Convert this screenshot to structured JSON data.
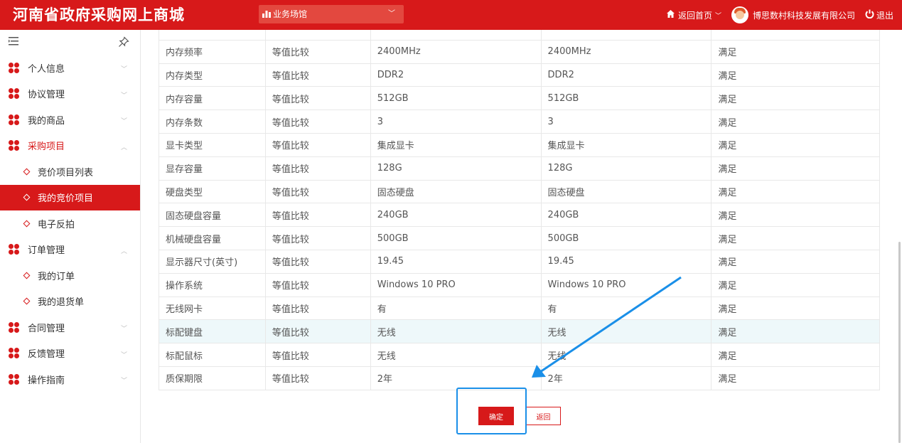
{
  "header": {
    "title": "河南省政府采购网上商城",
    "hall_label": "业务场馆",
    "home_label": "返回首页",
    "company": "博思数村科技发展有限公司",
    "logout_label": "退出"
  },
  "sidebar": {
    "items": [
      {
        "label": "个人信息",
        "level": "top",
        "state": "collapsed"
      },
      {
        "label": "协议管理",
        "level": "top",
        "state": "collapsed"
      },
      {
        "label": "我的商品",
        "level": "top",
        "state": "collapsed"
      },
      {
        "label": "采购项目",
        "level": "top",
        "state": "open"
      },
      {
        "label": "竞价项目列表",
        "level": "sub",
        "state": "normal"
      },
      {
        "label": "我的竞价项目",
        "level": "sub",
        "state": "active"
      },
      {
        "label": "电子反拍",
        "level": "sub",
        "state": "normal"
      },
      {
        "label": "订单管理",
        "level": "top",
        "state": "expanded"
      },
      {
        "label": "我的订单",
        "level": "sub",
        "state": "normal"
      },
      {
        "label": "我的退货单",
        "level": "sub",
        "state": "normal"
      },
      {
        "label": "合同管理",
        "level": "top",
        "state": "collapsed"
      },
      {
        "label": "反馈管理",
        "level": "top",
        "state": "collapsed"
      },
      {
        "label": "操作指南",
        "level": "top",
        "state": "collapsed"
      }
    ]
  },
  "table": {
    "rows": [
      [
        "",
        "",
        "",
        "",
        ""
      ],
      [
        "内存频率",
        "等值比较",
        "2400MHz",
        "2400MHz",
        "满足"
      ],
      [
        "内存类型",
        "等值比较",
        "DDR2",
        "DDR2",
        "满足"
      ],
      [
        "内存容量",
        "等值比较",
        "512GB",
        "512GB",
        "满足"
      ],
      [
        "内存条数",
        "等值比较",
        "3",
        "3",
        "满足"
      ],
      [
        "显卡类型",
        "等值比较",
        "集成显卡",
        "集成显卡",
        "满足"
      ],
      [
        "显存容量",
        "等值比较",
        "128G",
        "128G",
        "满足"
      ],
      [
        "硬盘类型",
        "等值比较",
        "固态硬盘",
        "固态硬盘",
        "满足"
      ],
      [
        "固态硬盘容量",
        "等值比较",
        "240GB",
        "240GB",
        "满足"
      ],
      [
        "机械硬盘容量",
        "等值比较",
        "500GB",
        "500GB",
        "满足"
      ],
      [
        "显示器尺寸(英寸)",
        "等值比较",
        "19.45",
        "19.45",
        "满足"
      ],
      [
        "操作系统",
        "等值比较",
        "Windows 10 PRO",
        "Windows 10 PRO",
        "满足"
      ],
      [
        "无线网卡",
        "等值比较",
        "有",
        "有",
        "满足"
      ],
      [
        "标配键盘",
        "等值比较",
        "无线",
        "无线",
        "满足"
      ],
      [
        "标配鼠标",
        "等值比较",
        "无线",
        "无线",
        "满足"
      ],
      [
        "质保期限",
        "等值比较",
        "2年",
        "2年",
        "满足"
      ]
    ],
    "highlighted_row": 13
  },
  "actions": {
    "confirm_label": "确定",
    "back_label": "返回"
  },
  "colors": {
    "brand_red": "#d7191a",
    "annotation_blue": "#1a8fe8",
    "row_highlight": "#eef8fa"
  }
}
